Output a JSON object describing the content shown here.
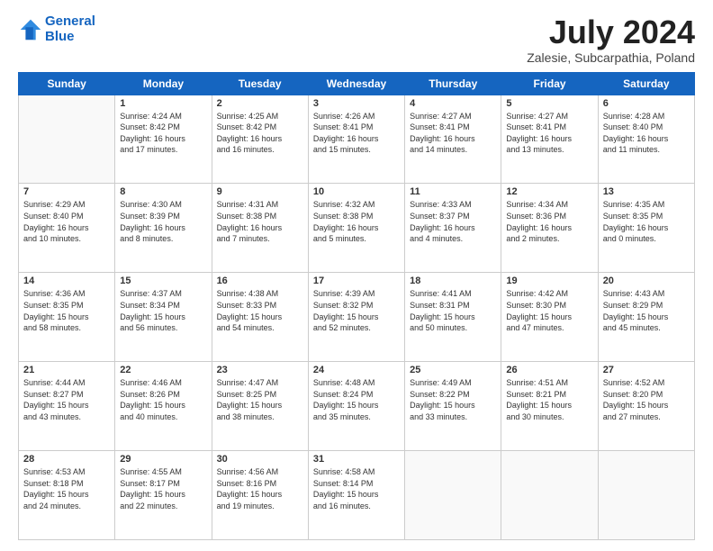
{
  "header": {
    "logo_line1": "General",
    "logo_line2": "Blue",
    "month": "July 2024",
    "location": "Zalesie, Subcarpathia, Poland"
  },
  "days_of_week": [
    "Sunday",
    "Monday",
    "Tuesday",
    "Wednesday",
    "Thursday",
    "Friday",
    "Saturday"
  ],
  "weeks": [
    [
      {
        "day": "",
        "info": ""
      },
      {
        "day": "1",
        "info": "Sunrise: 4:24 AM\nSunset: 8:42 PM\nDaylight: 16 hours\nand 17 minutes."
      },
      {
        "day": "2",
        "info": "Sunrise: 4:25 AM\nSunset: 8:42 PM\nDaylight: 16 hours\nand 16 minutes."
      },
      {
        "day": "3",
        "info": "Sunrise: 4:26 AM\nSunset: 8:41 PM\nDaylight: 16 hours\nand 15 minutes."
      },
      {
        "day": "4",
        "info": "Sunrise: 4:27 AM\nSunset: 8:41 PM\nDaylight: 16 hours\nand 14 minutes."
      },
      {
        "day": "5",
        "info": "Sunrise: 4:27 AM\nSunset: 8:41 PM\nDaylight: 16 hours\nand 13 minutes."
      },
      {
        "day": "6",
        "info": "Sunrise: 4:28 AM\nSunset: 8:40 PM\nDaylight: 16 hours\nand 11 minutes."
      }
    ],
    [
      {
        "day": "7",
        "info": "Sunrise: 4:29 AM\nSunset: 8:40 PM\nDaylight: 16 hours\nand 10 minutes."
      },
      {
        "day": "8",
        "info": "Sunrise: 4:30 AM\nSunset: 8:39 PM\nDaylight: 16 hours\nand 8 minutes."
      },
      {
        "day": "9",
        "info": "Sunrise: 4:31 AM\nSunset: 8:38 PM\nDaylight: 16 hours\nand 7 minutes."
      },
      {
        "day": "10",
        "info": "Sunrise: 4:32 AM\nSunset: 8:38 PM\nDaylight: 16 hours\nand 5 minutes."
      },
      {
        "day": "11",
        "info": "Sunrise: 4:33 AM\nSunset: 8:37 PM\nDaylight: 16 hours\nand 4 minutes."
      },
      {
        "day": "12",
        "info": "Sunrise: 4:34 AM\nSunset: 8:36 PM\nDaylight: 16 hours\nand 2 minutes."
      },
      {
        "day": "13",
        "info": "Sunrise: 4:35 AM\nSunset: 8:35 PM\nDaylight: 16 hours\nand 0 minutes."
      }
    ],
    [
      {
        "day": "14",
        "info": "Sunrise: 4:36 AM\nSunset: 8:35 PM\nDaylight: 15 hours\nand 58 minutes."
      },
      {
        "day": "15",
        "info": "Sunrise: 4:37 AM\nSunset: 8:34 PM\nDaylight: 15 hours\nand 56 minutes."
      },
      {
        "day": "16",
        "info": "Sunrise: 4:38 AM\nSunset: 8:33 PM\nDaylight: 15 hours\nand 54 minutes."
      },
      {
        "day": "17",
        "info": "Sunrise: 4:39 AM\nSunset: 8:32 PM\nDaylight: 15 hours\nand 52 minutes."
      },
      {
        "day": "18",
        "info": "Sunrise: 4:41 AM\nSunset: 8:31 PM\nDaylight: 15 hours\nand 50 minutes."
      },
      {
        "day": "19",
        "info": "Sunrise: 4:42 AM\nSunset: 8:30 PM\nDaylight: 15 hours\nand 47 minutes."
      },
      {
        "day": "20",
        "info": "Sunrise: 4:43 AM\nSunset: 8:29 PM\nDaylight: 15 hours\nand 45 minutes."
      }
    ],
    [
      {
        "day": "21",
        "info": "Sunrise: 4:44 AM\nSunset: 8:27 PM\nDaylight: 15 hours\nand 43 minutes."
      },
      {
        "day": "22",
        "info": "Sunrise: 4:46 AM\nSunset: 8:26 PM\nDaylight: 15 hours\nand 40 minutes."
      },
      {
        "day": "23",
        "info": "Sunrise: 4:47 AM\nSunset: 8:25 PM\nDaylight: 15 hours\nand 38 minutes."
      },
      {
        "day": "24",
        "info": "Sunrise: 4:48 AM\nSunset: 8:24 PM\nDaylight: 15 hours\nand 35 minutes."
      },
      {
        "day": "25",
        "info": "Sunrise: 4:49 AM\nSunset: 8:22 PM\nDaylight: 15 hours\nand 33 minutes."
      },
      {
        "day": "26",
        "info": "Sunrise: 4:51 AM\nSunset: 8:21 PM\nDaylight: 15 hours\nand 30 minutes."
      },
      {
        "day": "27",
        "info": "Sunrise: 4:52 AM\nSunset: 8:20 PM\nDaylight: 15 hours\nand 27 minutes."
      }
    ],
    [
      {
        "day": "28",
        "info": "Sunrise: 4:53 AM\nSunset: 8:18 PM\nDaylight: 15 hours\nand 24 minutes."
      },
      {
        "day": "29",
        "info": "Sunrise: 4:55 AM\nSunset: 8:17 PM\nDaylight: 15 hours\nand 22 minutes."
      },
      {
        "day": "30",
        "info": "Sunrise: 4:56 AM\nSunset: 8:16 PM\nDaylight: 15 hours\nand 19 minutes."
      },
      {
        "day": "31",
        "info": "Sunrise: 4:58 AM\nSunset: 8:14 PM\nDaylight: 15 hours\nand 16 minutes."
      },
      {
        "day": "",
        "info": ""
      },
      {
        "day": "",
        "info": ""
      },
      {
        "day": "",
        "info": ""
      }
    ]
  ]
}
